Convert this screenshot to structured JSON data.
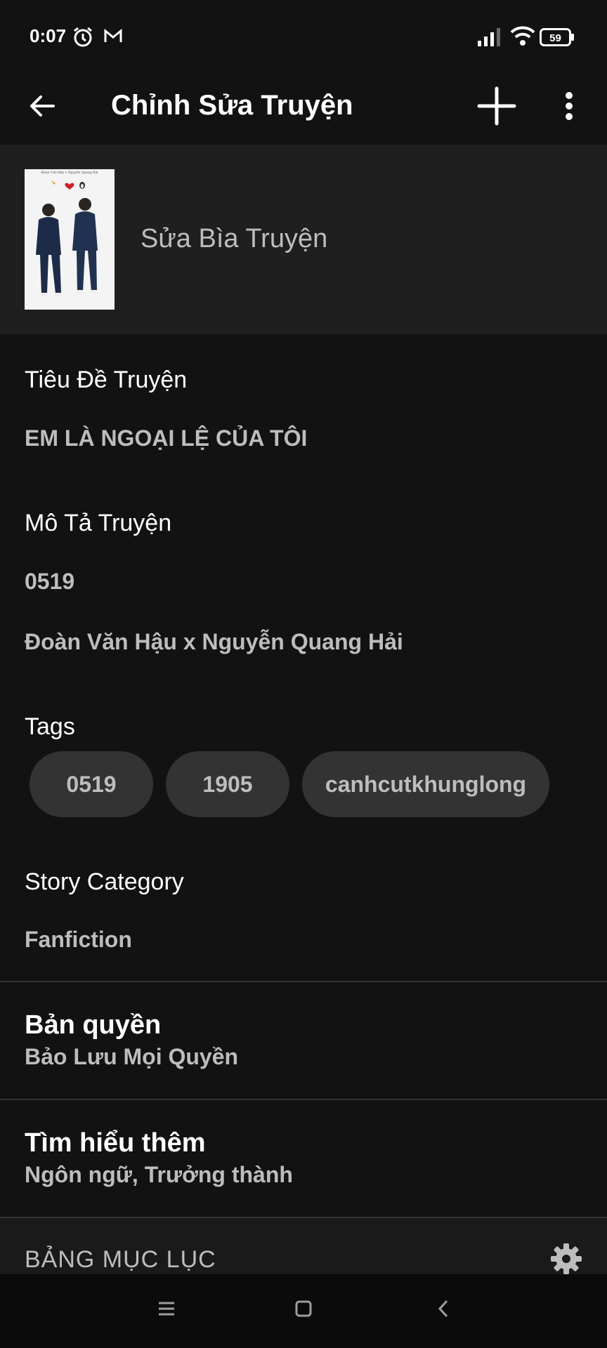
{
  "status_bar": {
    "time": "0:07",
    "battery": "59",
    "icons": [
      "alarm-icon",
      "gmail-icon",
      "signal-icon",
      "wifi-icon",
      "battery-icon"
    ]
  },
  "app_bar": {
    "title": "Chỉnh Sửa Truyện",
    "icons": [
      "back-arrow-icon",
      "plus-icon",
      "more-vertical-icon"
    ]
  },
  "cover": {
    "label": "Sửa Bìa Truyện",
    "image_caption": "Đoàn Văn Hậu x Nguyễn Quang Hải"
  },
  "fields": {
    "title_label": "Tiêu Đề Truyện",
    "title_value": "EM LÀ NGOẠI LỆ CỦA TÔI",
    "description_label": "Mô Tả Truyện",
    "description_line1": "0519",
    "description_line2": "Đoàn Văn Hậu x Nguyễn Quang Hải",
    "tags_label": "Tags",
    "tags": [
      "0519",
      "1905",
      "canhcutkhunglong"
    ],
    "category_label": "Story Category",
    "category_value": "Fanfiction"
  },
  "copyright": {
    "title": "Bản quyền",
    "value": "Bảo Lưu Mọi Quyền"
  },
  "learn_more": {
    "title": "Tìm hiểu thêm",
    "value": "Ngôn ngữ, Trưởng thành"
  },
  "toc": {
    "label": "BẢNG MỤC LỤC"
  },
  "nav_bar": {
    "icons": [
      "menu-icon",
      "home-square-icon",
      "back-chevron-icon"
    ]
  },
  "colors": {
    "background": "#121212",
    "surface": "#1f1f1f",
    "chip": "#333333",
    "secondary_text": "#bdbdbd"
  }
}
